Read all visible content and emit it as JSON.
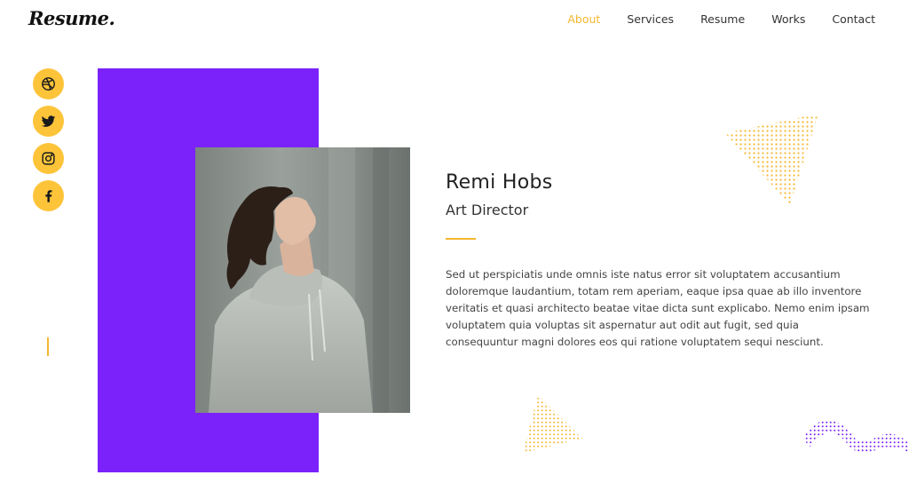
{
  "brand": {
    "logo": "Resume."
  },
  "nav": {
    "items": [
      "About",
      "Services",
      "Resume",
      "Works",
      "Contact"
    ],
    "active_index": 0
  },
  "social": [
    "dribbble-icon",
    "twitter-icon",
    "instagram-icon",
    "facebook-icon"
  ],
  "profile": {
    "name": "Remi Hobs",
    "role": "Art Director",
    "bio": "Sed ut perspiciatis unde omnis iste natus error sit voluptatem accusantium doloremque laudantium, totam rem aperiam, eaque ipsa quae ab illo inventore veritatis et quasi architecto beatae vitae dicta sunt explicabo. Nemo enim ipsam voluptatem quia voluptas sit aspernatur aut odit aut fugit, sed quia consequuntur magni dolores eos qui ratione voluptatem sequi nesciunt."
  },
  "colors": {
    "accent": "#f5b731",
    "icon_bg": "#fdc43a",
    "purple": "#7b22fb",
    "text": "#222222"
  }
}
